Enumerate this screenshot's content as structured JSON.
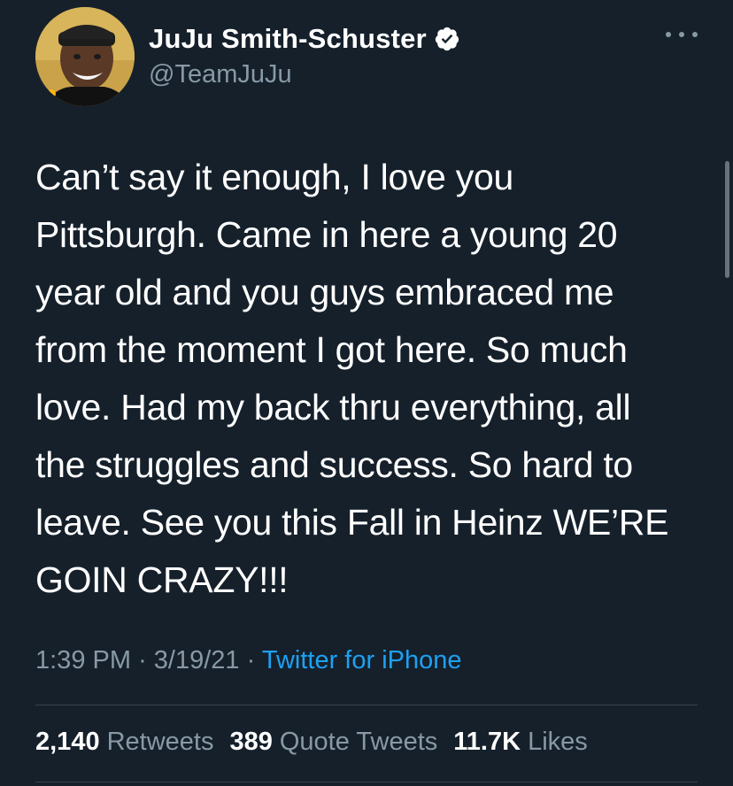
{
  "author": {
    "display_name": "JuJu Smith-Schuster",
    "handle": "@TeamJuJu",
    "verified": true,
    "avatar_icon": "profile-photo"
  },
  "menu": {
    "icon": "more-options-icon"
  },
  "tweet": {
    "text": "Can’t say it enough, I love you\nPittsburgh. Came in here a young 20\nyear old and you guys embraced me\nfrom the moment I got here. So much\nlove. Had my back thru everything, all\nthe struggles and success. So hard to\nleave. See you this Fall in Heinz WE’RE\nGOIN CRAZY!!!"
  },
  "meta": {
    "time": "1:39 PM",
    "date": "3/19/21",
    "separator": "·",
    "source": "Twitter for iPhone"
  },
  "stats": {
    "retweets_count": "2,140",
    "retweets_label": "Retweets",
    "quote_count": "389",
    "quote_label": "Quote Tweets",
    "likes_count": "11.7K",
    "likes_label": "Likes"
  },
  "colors": {
    "background": "#15202b",
    "primary_text": "#ffffff",
    "secondary_text": "#8899a6",
    "link": "#1da1f2",
    "divider": "#38444d"
  }
}
